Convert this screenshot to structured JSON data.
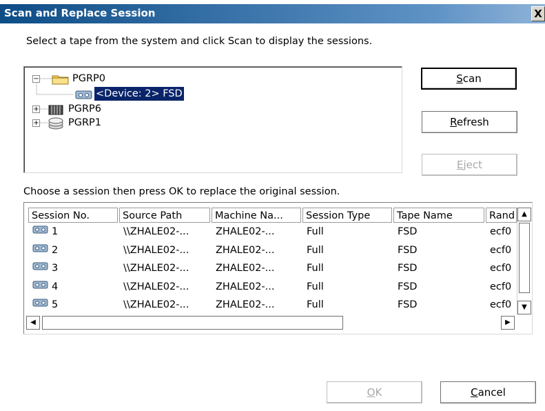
{
  "window": {
    "title": "Scan and Replace Session",
    "close_glyph": "X"
  },
  "instructions": {
    "select_tape": "Select a tape from the system and click Scan to display the sessions.",
    "choose_session": "Choose a session then press OK to replace the original session."
  },
  "tree": {
    "nodes": [
      {
        "label": "PGRP0",
        "expander": "−",
        "icon": "folder-icon"
      },
      {
        "label": "<Device: 2> FSD",
        "icon": "tape-device-icon",
        "selected": true
      },
      {
        "label": "PGRP6",
        "expander": "+",
        "icon": "tape-library-icon"
      },
      {
        "label": "PGRP1",
        "expander": "+",
        "icon": "tape-stack-icon"
      }
    ]
  },
  "buttons": {
    "scan": {
      "label": "Scan",
      "mnemonic_index": 0
    },
    "refresh": {
      "label": "Refresh",
      "mnemonic_index": 0
    },
    "eject": {
      "label": "Eject",
      "mnemonic_index": 0,
      "disabled": true
    },
    "ok": {
      "label": "OK",
      "mnemonic_index": 0,
      "disabled": true
    },
    "cancel": {
      "label": "Cancel",
      "mnemonic_index": 0
    }
  },
  "sessions": {
    "columns": [
      "Session No.",
      "Source Path",
      "Machine Na...",
      "Session Type",
      "Tape Name",
      "Rand"
    ],
    "rows": [
      [
        "1",
        "\\\\ZHALE02-...",
        "ZHALE02-...",
        "Full",
        "FSD",
        "ecf0"
      ],
      [
        "2",
        "\\\\ZHALE02-...",
        "ZHALE02-...",
        "Full",
        "FSD",
        "ecf0"
      ],
      [
        "3",
        "\\\\ZHALE02-...",
        "ZHALE02-...",
        "Full",
        "FSD",
        "ecf0"
      ],
      [
        "4",
        "\\\\ZHALE02-...",
        "ZHALE02-...",
        "Full",
        "FSD",
        "ecf0"
      ],
      [
        "5",
        "\\\\ZHALE02-...",
        "ZHALE02-...",
        "Full",
        "FSD",
        "ecf0"
      ]
    ]
  },
  "scroll": {
    "up": "▲",
    "down": "▼",
    "left": "◀",
    "right": "▶"
  }
}
